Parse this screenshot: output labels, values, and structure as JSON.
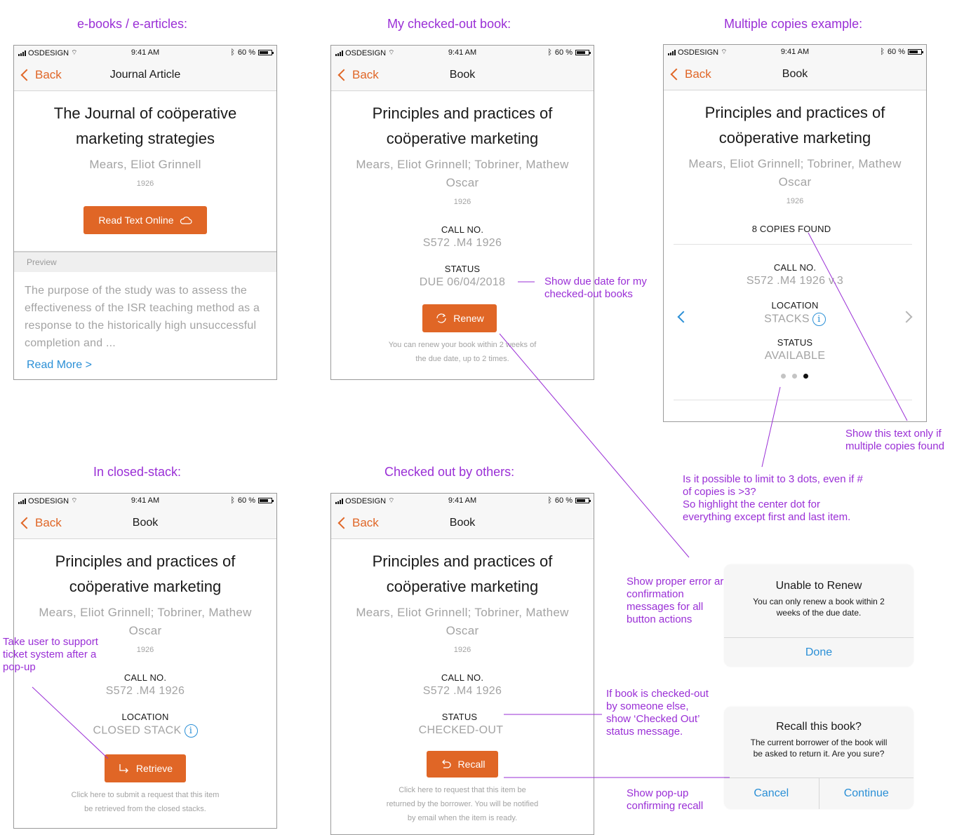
{
  "section_titles": {
    "ebooks": "e-books / e-articles:",
    "my_checked_out": "My checked-out book:",
    "multiple_copies": "Multiple copies example:",
    "closed_stack": "In closed-stack:",
    "checked_by_others": "Checked out by others:"
  },
  "statusbar": {
    "carrier": "OSDESIGN",
    "time": "9:41 AM",
    "battery": "60 %"
  },
  "nav": {
    "back": "Back"
  },
  "screens": {
    "ebook": {
      "nav_title": "Journal Article",
      "title_line1": "The Journal of coöperative",
      "title_line2": "marketing strategies",
      "authors": "Mears, Eliot Grinnell",
      "year": "1926",
      "button": "Read Text Online",
      "preview_label": "Preview",
      "preview_text": "The purpose of the study was to assess the effectiveness of the ISR teaching method as a response to the historically high unsuccessful completion and ...",
      "read_more": "Read More >"
    },
    "checked_out": {
      "nav_title": "Book",
      "title_line1": "Principles and practices of",
      "title_line2": "coöperative marketing",
      "authors_line1": "Mears, Eliot Grinnell; Tobriner, Mathew",
      "authors_line2": "Oscar",
      "year": "1926",
      "call_label": "CALL NO.",
      "call_value": "S572 .M4 1926",
      "status_label": "STATUS",
      "status_value": "DUE 06/04/2018",
      "button": "Renew",
      "hint_line1": "You can renew your book within 2 weeks of",
      "hint_line2": "the due date, up to 2 times."
    },
    "multiple": {
      "nav_title": "Book",
      "title_line1": "Principles and practices of",
      "title_line2": "coöperative marketing",
      "authors_line1": "Mears, Eliot Grinnell; Tobriner, Mathew",
      "authors_line2": "Oscar",
      "year": "1926",
      "copies": "8 COPIES FOUND",
      "call_label": "CALL NO.",
      "call_value": "S572 .M4 1926  v.3",
      "location_label": "LOCATION",
      "location_value": "STACKS",
      "status_label": "STATUS",
      "status_value": "AVAILABLE",
      "dots": {
        "count": 3,
        "active_index": 2
      }
    },
    "closed_stack": {
      "nav_title": "Book",
      "title_line1": "Principles and practices of",
      "title_line2": "coöperative marketing",
      "authors_line1": "Mears, Eliot Grinnell; Tobriner, Mathew",
      "authors_line2": "Oscar",
      "year": "1926",
      "call_label": "CALL NO.",
      "call_value": "S572 .M4 1926",
      "location_label": "LOCATION",
      "location_value": "CLOSED STACK",
      "button": "Retrieve",
      "hint_line1": "Click here to submit a request that this item",
      "hint_line2": "be retrieved from the closed stacks."
    },
    "others": {
      "nav_title": "Book",
      "title_line1": "Principles and practices of",
      "title_line2": "coöperative marketing",
      "authors_line1": "Mears, Eliot Grinnell; Tobriner, Mathew",
      "authors_line2": "Oscar",
      "year": "1926",
      "call_label": "CALL NO.",
      "call_value": "S572 .M4 1926",
      "status_label": "STATUS",
      "status_value": "CHECKED-OUT",
      "button": "Recall",
      "hint_line1": "Click here to request that this item be",
      "hint_line2": "returned by the borrower. You will be notified",
      "hint_line3": "by email when the item is ready."
    }
  },
  "dialogs": {
    "renew": {
      "title": "Unable to Renew",
      "message_line1": "You can only renew a book within 2",
      "message_line2": "weeks of the due date.",
      "action": "Done"
    },
    "recall": {
      "title": "Recall this book?",
      "message_line1": "The current borrower of the book will",
      "message_line2": "be asked to return it. Are you sure?",
      "cancel": "Cancel",
      "continue": "Continue"
    }
  },
  "notes": {
    "due_date_line1": "Show due date for my",
    "due_date_line2": "checked-out books",
    "copies_only_line1": "Show this text only if",
    "copies_only_line2": "multiple copies found",
    "dots_line1": "Is it possible to limit to 3 dots, even if #",
    "dots_line2": "of copies is >3?",
    "dots_line3": "So highlight the center dot for",
    "dots_line4": "everything except first and last item.",
    "error_line1": "Show proper error ar",
    "error_line2": "confirmation",
    "error_line3": "messages for all",
    "error_line4": "button actions",
    "support_line1": "Take user to support",
    "support_line2": "ticket system after a",
    "support_line3": "pop-up",
    "checked_line1": "If book is checked-out",
    "checked_line2": "by someone else,",
    "checked_line3": "show  ‘Checked Out’",
    "checked_line4": "status message.",
    "popup_line1": "Show pop-up",
    "popup_line2": "confirming recall"
  },
  "colors": {
    "accent": "#e06626",
    "annotation": "#9a2fd6",
    "link": "#2a8fd6",
    "muted": "#a3a3a3"
  }
}
